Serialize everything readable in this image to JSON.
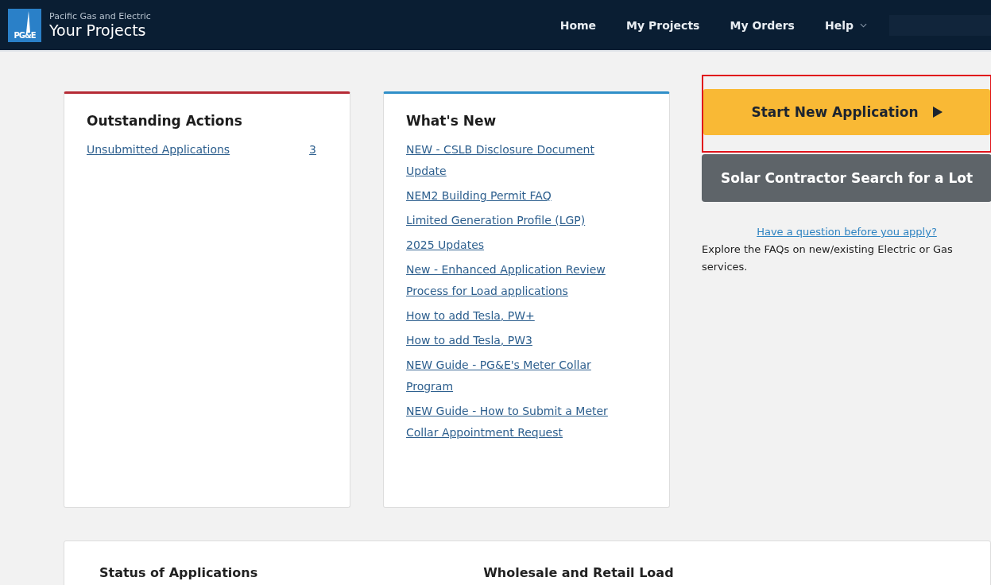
{
  "header": {
    "logo_text": "PG&E",
    "company": "Pacific Gas and Electric",
    "title": "Your Projects",
    "nav": [
      {
        "label": "Home",
        "dropdown": false
      },
      {
        "label": "My Projects",
        "dropdown": false
      },
      {
        "label": "My Orders",
        "dropdown": false
      },
      {
        "label": "Help",
        "dropdown": true
      }
    ]
  },
  "outstanding_actions": {
    "title": "Outstanding Actions",
    "items": [
      {
        "label": "Unsubmitted Applications",
        "count": "3"
      }
    ]
  },
  "whats_new": {
    "title": "What's New",
    "links": [
      "NEW - CSLB Disclosure Document Update",
      "NEM2 Building Permit FAQ",
      "Limited Generation Profile (LGP)",
      "2025 Updates",
      "New - Enhanced Application Review Process for Load applications",
      "How to add Tesla, PW+",
      "How to add Tesla, PW3",
      "NEW Guide - PG&E's Meter Collar Program",
      "NEW Guide - How to Submit a Meter Collar Appointment Request"
    ]
  },
  "actions": {
    "primary": {
      "label": "Start New Application",
      "highlighted": true
    },
    "secondary": {
      "label": "Solar Contractor Search for a Lot"
    },
    "question_link": "Have a question before you apply?",
    "question_text": "Explore the FAQs on new/existing Electric or Gas services."
  },
  "bottom_panel": {
    "status_title": "Status of Applications",
    "load_title": "Wholesale and Retail Load"
  }
}
